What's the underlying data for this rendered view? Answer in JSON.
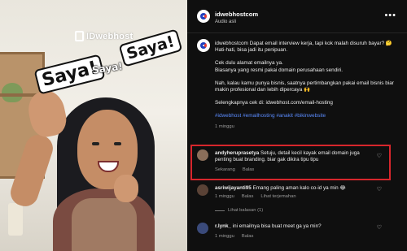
{
  "media": {
    "brand": "IDwebhost",
    "stickers": [
      "Saya!",
      "Saya!",
      "Saya!"
    ]
  },
  "post": {
    "username": "idwebhostcom",
    "audio": "Audio asli",
    "more_icon": "more-horizontal-icon",
    "caption": [
      "idwebhostcom Dapat email interview kerja, tapi kok malah disuruh bayar? 🤔",
      "Hati-hati, bisa jadi itu penipuan.",
      "Cek dulu alamat emailnya ya.",
      "Biasanya yang resmi pakai domain perusahaan sendiri.",
      "Nah, kalau kamu punya bisnis, saatnya pertimbangkan pakai email bisnis biar makin profesional dan lebih dipercaya 🙌",
      "Selengkapnya cek di: idwebhost.com/email-hosting"
    ],
    "hashtags": "#idwebhost #emailhosting #anakit #bikinwebsite",
    "time": "1 minggu"
  },
  "comments": [
    {
      "user": "andyheruprasetya",
      "text": "Setuju, detail kecil kayak email domain juga penting buat branding. biar gak dikira tipu tipu",
      "time": "Sekarang",
      "reply": "Balas",
      "highlighted": true,
      "avatar_color": "#8a6e5a"
    },
    {
      "user": "asriwijayanti95",
      "text": "Emang paling aman kalo co-id ya min 😂",
      "time": "1 minggu",
      "reply": "Balas",
      "translate": "Lihat terjemahan",
      "view_replies": "Lihat balasan (1)",
      "avatar_color": "#5a4236"
    },
    {
      "user": "r.lynk_",
      "text": "ini emailnya bisa buat meet ga ya min?",
      "time": "1 minggu",
      "reply": "Balas",
      "avatar_color": "#3a4a7a"
    }
  ],
  "colors": {
    "highlight_border": "#d7262c",
    "hashtag": "#5b8cff",
    "panel_bg": "#0f0f0f"
  }
}
